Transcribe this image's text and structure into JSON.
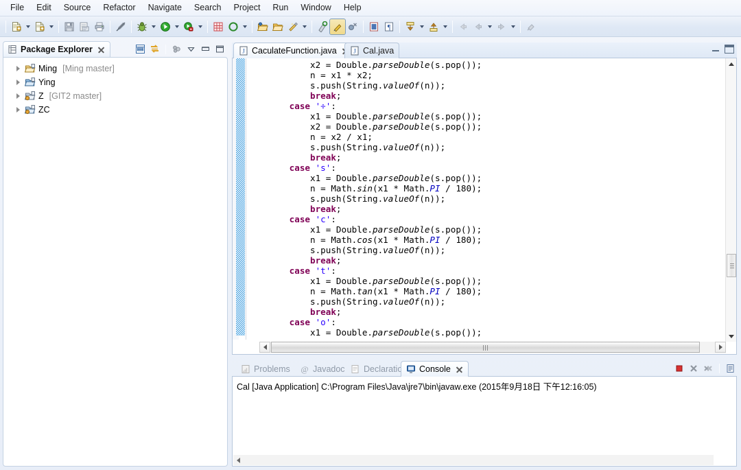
{
  "menu": {
    "items": [
      "File",
      "Edit",
      "Source",
      "Refactor",
      "Navigate",
      "Search",
      "Project",
      "Run",
      "Window",
      "Help"
    ]
  },
  "toolbar": {
    "buttons": [
      {
        "name": "new-wizard",
        "icon": "new-file-icon",
        "dropdown": true
      },
      {
        "name": "new-java-class",
        "icon": "new-class-icon",
        "dropdown": true
      },
      {
        "name": "save",
        "icon": "save-disk-icon",
        "dropdown": false
      },
      {
        "name": "print-preview",
        "icon": "print-preview-icon",
        "dropdown": false
      },
      {
        "name": "print",
        "icon": "printer-icon",
        "dropdown": false
      },
      {
        "name": "toggle-mark-occurrences",
        "icon": "pencil-slash-icon",
        "dropdown": false
      },
      {
        "name": "debug",
        "icon": "bug-icon",
        "dropdown": true
      },
      {
        "name": "run",
        "icon": "run-green-play-icon",
        "dropdown": true
      },
      {
        "name": "run-external-tools",
        "icon": "external-tools-icon",
        "dropdown": true
      },
      {
        "name": "new-java-project",
        "icon": "grid-plus-icon",
        "dropdown": false
      },
      {
        "name": "open-type",
        "icon": "open-type-icon",
        "dropdown": true
      },
      {
        "name": "open-task",
        "icon": "folder-open-icon",
        "dropdown": false
      },
      {
        "name": "open-folder",
        "icon": "folder-icon",
        "dropdown": false
      },
      {
        "name": "quick-fix",
        "icon": "wand-icon",
        "dropdown": true
      },
      {
        "name": "search",
        "icon": "search-marker-icon",
        "dropdown": false
      },
      {
        "name": "toggle-mark-occurrences-active",
        "icon": "highlighter-icon",
        "dropdown": false,
        "pressed": true
      },
      {
        "name": "skip-breakpoints",
        "icon": "skip-breakpoint-icon",
        "dropdown": false
      },
      {
        "name": "show-whitespace",
        "icon": "show-whitespace-icon",
        "dropdown": false
      },
      {
        "name": "pilcrow",
        "icon": "pilcrow-icon",
        "dropdown": false
      },
      {
        "name": "next-annotation",
        "icon": "down-arrow-yellow-icon",
        "dropdown": true
      },
      {
        "name": "previous-annotation",
        "icon": "up-arrow-yellow-icon",
        "dropdown": true
      },
      {
        "name": "back",
        "icon": "back-arrow-icon",
        "dropdown": false
      },
      {
        "name": "back-history",
        "icon": "back-arrow-icon",
        "dropdown": true
      },
      {
        "name": "forward",
        "icon": "forward-arrow-icon",
        "dropdown": true
      },
      {
        "name": "pin-editor",
        "icon": "pin-icon",
        "dropdown": false
      }
    ]
  },
  "package_explorer": {
    "title": "Package Explorer",
    "toolbar": [
      {
        "name": "collapse-all",
        "icon": "collapse-all-icon"
      },
      {
        "name": "link-with-editor",
        "icon": "link-editor-icon"
      },
      {
        "name": "focus-on-active-task",
        "icon": "focus-task-icon"
      },
      {
        "name": "view-menu",
        "icon": "chevron-down-icon"
      },
      {
        "name": "minimize-view",
        "icon": "minimize-icon"
      },
      {
        "name": "maximize-view",
        "icon": "maximize-icon"
      }
    ],
    "tree": [
      {
        "name": "Ming",
        "branch": "[Ming master]",
        "icon": "java-project-icon"
      },
      {
        "name": "Ying",
        "branch": "",
        "icon": "java-project-icon"
      },
      {
        "name": "Z",
        "branch": "[GIT2 master]",
        "icon": "java-project-icon"
      },
      {
        "name": "ZC",
        "branch": "",
        "icon": "java-project-icon"
      }
    ]
  },
  "editor": {
    "tabs": [
      {
        "label": "CaculateFunction.java",
        "active": true,
        "icon": "java-file-icon",
        "closable": true
      },
      {
        "label": "Cal.java",
        "active": false,
        "icon": "java-file-icon",
        "closable": false
      }
    ],
    "window_buttons": [
      {
        "name": "minimize-editor",
        "icon": "minimize-icon"
      },
      {
        "name": "maximize-editor",
        "icon": "maximize-icon"
      }
    ],
    "code_lines": [
      {
        "indent": 12,
        "tokens": [
          {
            "t": "x2 = Double.",
            "c": "plain"
          },
          {
            "t": "parseDouble",
            "c": "stat"
          },
          {
            "t": "(s.pop());",
            "c": "plain"
          }
        ]
      },
      {
        "indent": 12,
        "tokens": [
          {
            "t": "n = x1 * x2;",
            "c": "plain"
          }
        ]
      },
      {
        "indent": 12,
        "tokens": [
          {
            "t": "s.push(String.",
            "c": "plain"
          },
          {
            "t": "valueOf",
            "c": "stat"
          },
          {
            "t": "(n));",
            "c": "plain"
          }
        ]
      },
      {
        "indent": 12,
        "tokens": [
          {
            "t": "break",
            "c": "kw"
          },
          {
            "t": ";",
            "c": "plain"
          }
        ]
      },
      {
        "indent": 8,
        "tokens": [
          {
            "t": "case ",
            "c": "kw"
          },
          {
            "t": "'÷'",
            "c": "str"
          },
          {
            "t": ":",
            "c": "plain"
          }
        ]
      },
      {
        "indent": 12,
        "tokens": [
          {
            "t": "x1 = Double.",
            "c": "plain"
          },
          {
            "t": "parseDouble",
            "c": "stat"
          },
          {
            "t": "(s.pop());",
            "c": "plain"
          }
        ]
      },
      {
        "indent": 12,
        "tokens": [
          {
            "t": "x2 = Double.",
            "c": "plain"
          },
          {
            "t": "parseDouble",
            "c": "stat"
          },
          {
            "t": "(s.pop());",
            "c": "plain"
          }
        ]
      },
      {
        "indent": 12,
        "tokens": [
          {
            "t": "n = x2 / x1;",
            "c": "plain"
          }
        ]
      },
      {
        "indent": 12,
        "tokens": [
          {
            "t": "s.push(String.",
            "c": "plain"
          },
          {
            "t": "valueOf",
            "c": "stat"
          },
          {
            "t": "(n));",
            "c": "plain"
          }
        ]
      },
      {
        "indent": 12,
        "tokens": [
          {
            "t": "break",
            "c": "kw"
          },
          {
            "t": ";",
            "c": "plain"
          }
        ]
      },
      {
        "indent": 8,
        "tokens": [
          {
            "t": "case ",
            "c": "kw"
          },
          {
            "t": "'s'",
            "c": "str"
          },
          {
            "t": ":",
            "c": "plain"
          }
        ]
      },
      {
        "indent": 12,
        "tokens": [
          {
            "t": "x1 = Double.",
            "c": "plain"
          },
          {
            "t": "parseDouble",
            "c": "stat"
          },
          {
            "t": "(s.pop());",
            "c": "plain"
          }
        ]
      },
      {
        "indent": 12,
        "tokens": [
          {
            "t": "n = Math.",
            "c": "plain"
          },
          {
            "t": "sin",
            "c": "stat"
          },
          {
            "t": "(x1 * Math.",
            "c": "plain"
          },
          {
            "t": "PI",
            "c": "field"
          },
          {
            "t": " / 180);",
            "c": "plain"
          }
        ]
      },
      {
        "indent": 12,
        "tokens": [
          {
            "t": "s.push(String.",
            "c": "plain"
          },
          {
            "t": "valueOf",
            "c": "stat"
          },
          {
            "t": "(n));",
            "c": "plain"
          }
        ]
      },
      {
        "indent": 12,
        "tokens": [
          {
            "t": "break",
            "c": "kw"
          },
          {
            "t": ";",
            "c": "plain"
          }
        ]
      },
      {
        "indent": 8,
        "tokens": [
          {
            "t": "case ",
            "c": "kw"
          },
          {
            "t": "'c'",
            "c": "str"
          },
          {
            "t": ":",
            "c": "plain"
          }
        ]
      },
      {
        "indent": 12,
        "tokens": [
          {
            "t": "x1 = Double.",
            "c": "plain"
          },
          {
            "t": "parseDouble",
            "c": "stat"
          },
          {
            "t": "(s.pop());",
            "c": "plain"
          }
        ]
      },
      {
        "indent": 12,
        "tokens": [
          {
            "t": "n = Math.",
            "c": "plain"
          },
          {
            "t": "cos",
            "c": "stat"
          },
          {
            "t": "(x1 * Math.",
            "c": "plain"
          },
          {
            "t": "PI",
            "c": "field"
          },
          {
            "t": " / 180);",
            "c": "plain"
          }
        ]
      },
      {
        "indent": 12,
        "tokens": [
          {
            "t": "s.push(String.",
            "c": "plain"
          },
          {
            "t": "valueOf",
            "c": "stat"
          },
          {
            "t": "(n));",
            "c": "plain"
          }
        ]
      },
      {
        "indent": 12,
        "tokens": [
          {
            "t": "break",
            "c": "kw"
          },
          {
            "t": ";",
            "c": "plain"
          }
        ]
      },
      {
        "indent": 8,
        "tokens": [
          {
            "t": "case ",
            "c": "kw"
          },
          {
            "t": "'t'",
            "c": "str"
          },
          {
            "t": ":",
            "c": "plain"
          }
        ]
      },
      {
        "indent": 12,
        "tokens": [
          {
            "t": "x1 = Double.",
            "c": "plain"
          },
          {
            "t": "parseDouble",
            "c": "stat"
          },
          {
            "t": "(s.pop());",
            "c": "plain"
          }
        ]
      },
      {
        "indent": 12,
        "tokens": [
          {
            "t": "n = Math.",
            "c": "plain"
          },
          {
            "t": "tan",
            "c": "stat"
          },
          {
            "t": "(x1 * Math.",
            "c": "plain"
          },
          {
            "t": "PI",
            "c": "field"
          },
          {
            "t": " / 180);",
            "c": "plain"
          }
        ]
      },
      {
        "indent": 12,
        "tokens": [
          {
            "t": "s.push(String.",
            "c": "plain"
          },
          {
            "t": "valueOf",
            "c": "stat"
          },
          {
            "t": "(n));",
            "c": "plain"
          }
        ]
      },
      {
        "indent": 12,
        "tokens": [
          {
            "t": "break",
            "c": "kw"
          },
          {
            "t": ";",
            "c": "plain"
          }
        ]
      },
      {
        "indent": 8,
        "tokens": [
          {
            "t": "case ",
            "c": "kw"
          },
          {
            "t": "'o'",
            "c": "str"
          },
          {
            "t": ":",
            "c": "plain"
          }
        ]
      },
      {
        "indent": 12,
        "tokens": [
          {
            "t": "x1 = Double.",
            "c": "plain"
          },
          {
            "t": "parseDouble",
            "c": "stat"
          },
          {
            "t": "(s.pop());",
            "c": "plain"
          }
        ]
      }
    ]
  },
  "console": {
    "tabs": [
      {
        "label": "Problems",
        "active": false,
        "icon": "problems-icon"
      },
      {
        "label": "Javadoc",
        "active": false,
        "icon": "javadoc-at-icon"
      },
      {
        "label": "Declaration",
        "active": false,
        "icon": "declaration-icon"
      },
      {
        "label": "Console",
        "active": true,
        "icon": "console-icon",
        "closable": true
      }
    ],
    "toolbar": [
      {
        "name": "terminate",
        "icon": "terminate-red-square-icon"
      },
      {
        "name": "remove-launch",
        "icon": "remove-x-icon"
      },
      {
        "name": "remove-all-terminated",
        "icon": "remove-all-xx-icon"
      },
      {
        "name": "display-selected-console",
        "icon": "display-console-icon"
      }
    ],
    "output": "Cal [Java Application] C:\\Program Files\\Java\\jre7\\bin\\javaw.exe (2015年9月18日 下午12:16:05)"
  },
  "colors": {
    "accent": "#4aa3e0",
    "keyword": "#7f0055",
    "string": "#2a00ff",
    "field": "#0000c0",
    "chrome": "#dfe8f5"
  }
}
